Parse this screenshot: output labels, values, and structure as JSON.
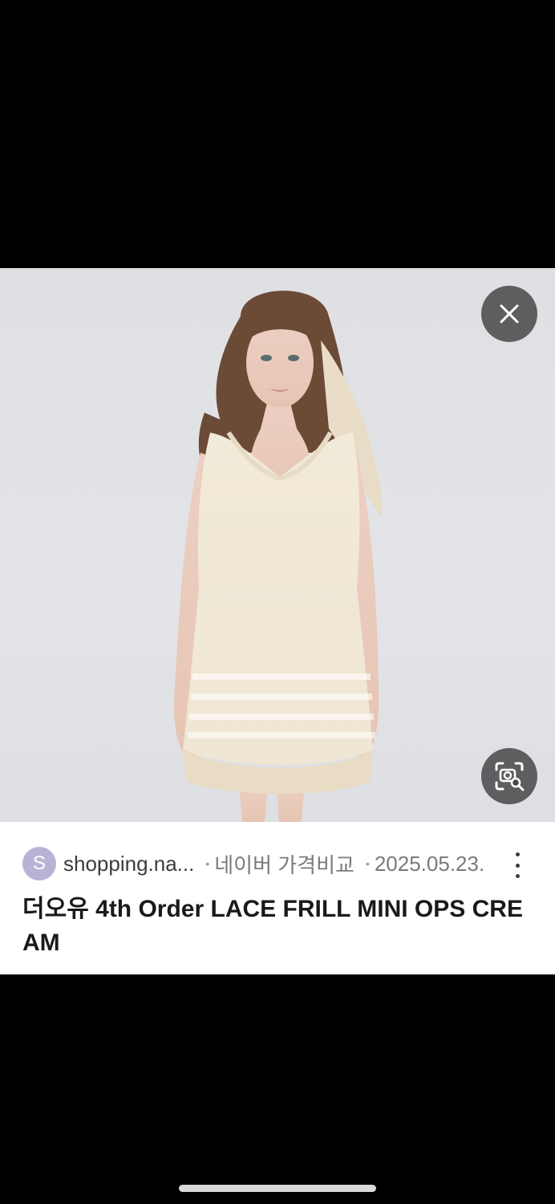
{
  "result": {
    "source_initial": "S",
    "site": "shopping.na...",
    "separator": "•",
    "source_label": "네이버 가격비교",
    "date": "2025.05.23.",
    "title": "더오유 4th Order LACE FRILL MINI OPS CREAM"
  },
  "icons": {
    "close": "close-icon",
    "lens": "image-search-icon",
    "more": "more-vertical-icon"
  },
  "colors": {
    "background": "#000000",
    "card": "#ffffff",
    "favicon": "#b8b3d4",
    "overlay_button": "#464648"
  }
}
